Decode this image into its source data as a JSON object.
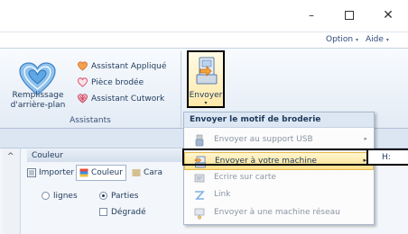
{
  "window": {
    "minimize_glyph": "–",
    "close_glyph": "✕"
  },
  "menubar": {
    "option_label": "Option",
    "aide_label": "Aide",
    "dropdown_glyph": "▾"
  },
  "ribbon": {
    "background_button": {
      "line1": "Remplissage",
      "line2": "d'arrière-plan"
    },
    "items": [
      {
        "label": "Assistant Appliqué",
        "icon": "heart-icon",
        "color": "#e8804a"
      },
      {
        "label": "Pièce brodée",
        "icon": "heart-outline-icon",
        "color": "#d84a6a"
      },
      {
        "label": "Assistant Cutwork",
        "icon": "heart-lattice-icon",
        "color": "#c23a55"
      }
    ],
    "group_label": "Assistants",
    "envoyer": {
      "label": "Envoyer",
      "chevron": "▾"
    }
  },
  "dropdown": {
    "title": "Envoyer le motif de broderie",
    "items": [
      {
        "label": "Envoyer au support USB",
        "icon": "usb-icon",
        "enabled": false,
        "has_submenu": true
      },
      {
        "label": "Envoyer à votre machine",
        "icon": "send-machine-icon",
        "enabled": true,
        "highlighted": true,
        "has_submenu": true
      },
      {
        "label": "Ecrire sur carte",
        "icon": "card-icon",
        "enabled": false,
        "has_submenu": false
      },
      {
        "label": "Link",
        "icon": "link-icon",
        "enabled": false,
        "has_submenu": false
      },
      {
        "label": "Envoyer à une machine réseau",
        "icon": "network-machine-icon",
        "enabled": false,
        "has_submenu": false
      }
    ],
    "submenu_glyph": "▸"
  },
  "panel": {
    "header": "Couleur",
    "tabs": [
      {
        "label": "Importer",
        "icon": "import-icon"
      },
      {
        "label": "Couleur",
        "icon": "color-icon"
      },
      {
        "label": "Cara",
        "icon": "character-icon"
      }
    ],
    "options": {
      "lignes": "lignes",
      "parties": "Parties",
      "degrade": "Dégradé"
    }
  },
  "callout": {
    "h_label": "H:"
  },
  "colors": {
    "accent": "#1e395b",
    "highlight": "#ffe08a"
  }
}
